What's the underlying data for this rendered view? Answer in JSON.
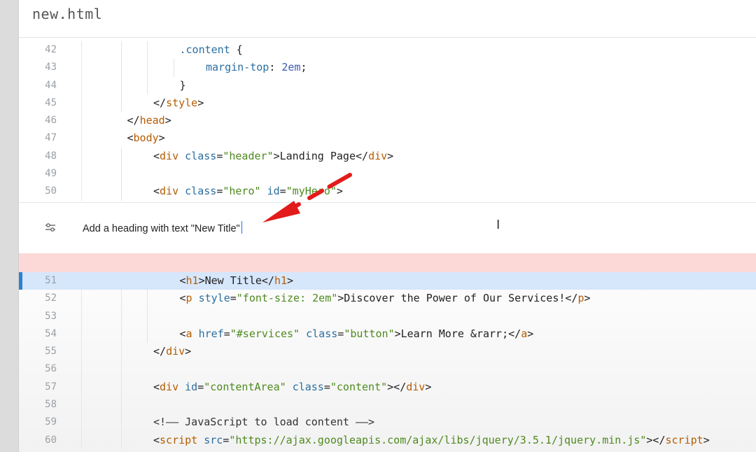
{
  "file": {
    "title": "new.html"
  },
  "code_top": [
    {
      "ln": "42",
      "tokens": [
        [
          "sel",
          ".content "
        ],
        [
          "p",
          "{"
        ]
      ],
      "indent": 3
    },
    {
      "ln": "43",
      "tokens": [
        [
          "a",
          "margin-top"
        ],
        [
          "p",
          ": "
        ],
        [
          "n",
          "2em"
        ],
        [
          "p",
          ";"
        ]
      ],
      "indent": 4
    },
    {
      "ln": "44",
      "tokens": [
        [
          "p",
          "}"
        ]
      ],
      "indent": 3
    },
    {
      "ln": "45",
      "tokens": [
        [
          "p",
          "</"
        ],
        [
          "t",
          "style"
        ],
        [
          "p",
          ">"
        ]
      ],
      "indent": 2
    },
    {
      "ln": "46",
      "tokens": [
        [
          "p",
          "</"
        ],
        [
          "t",
          "head"
        ],
        [
          "p",
          ">"
        ]
      ],
      "indent": 1
    },
    {
      "ln": "47",
      "tokens": [
        [
          "p",
          "<"
        ],
        [
          "t",
          "body"
        ],
        [
          "p",
          ">"
        ]
      ],
      "indent": 1
    },
    {
      "ln": "48",
      "tokens": [
        [
          "p",
          "<"
        ],
        [
          "t",
          "div"
        ],
        [
          "p",
          " "
        ],
        [
          "a",
          "class"
        ],
        [
          "p",
          "="
        ],
        [
          "s",
          "\"header\""
        ],
        [
          "p",
          ">Landing Page</"
        ],
        [
          "t",
          "div"
        ],
        [
          "p",
          ">"
        ]
      ],
      "indent": 2
    },
    {
      "ln": "49",
      "tokens": [],
      "indent": 2
    },
    {
      "ln": "50",
      "tokens": [
        [
          "p",
          "<"
        ],
        [
          "t",
          "div"
        ],
        [
          "p",
          " "
        ],
        [
          "a",
          "class"
        ],
        [
          "p",
          "="
        ],
        [
          "s",
          "\"hero\""
        ],
        [
          "p",
          " "
        ],
        [
          "a",
          "id"
        ],
        [
          "p",
          "="
        ],
        [
          "s",
          "\"myHero\""
        ],
        [
          "p",
          ">"
        ]
      ],
      "indent": 2
    }
  ],
  "prompt": {
    "text": "Add a heading with text \"New Title\"",
    "icon": "sliders-icon"
  },
  "code_bottom": [
    {
      "ln": "51",
      "tokens": [
        [
          "p",
          "<"
        ],
        [
          "t",
          "h1"
        ],
        [
          "p",
          ">New Title</"
        ],
        [
          "t",
          "h1"
        ],
        [
          "p",
          ">"
        ]
      ],
      "indent": 3,
      "highlight": true
    },
    {
      "ln": "52",
      "tokens": [
        [
          "p",
          "<"
        ],
        [
          "t",
          "p"
        ],
        [
          "p",
          " "
        ],
        [
          "a",
          "style"
        ],
        [
          "p",
          "="
        ],
        [
          "s",
          "\"font-size: 2em\""
        ],
        [
          "p",
          ">Discover the Power of Our Services!</"
        ],
        [
          "t",
          "p"
        ],
        [
          "p",
          ">"
        ]
      ],
      "indent": 3
    },
    {
      "ln": "53",
      "tokens": [],
      "indent": 3
    },
    {
      "ln": "54",
      "tokens": [
        [
          "p",
          "<"
        ],
        [
          "t",
          "a"
        ],
        [
          "p",
          " "
        ],
        [
          "a",
          "href"
        ],
        [
          "p",
          "="
        ],
        [
          "s",
          "\"#services\""
        ],
        [
          "p",
          " "
        ],
        [
          "a",
          "class"
        ],
        [
          "p",
          "="
        ],
        [
          "s",
          "\"button\""
        ],
        [
          "p",
          ">Learn More &rarr;</"
        ],
        [
          "t",
          "a"
        ],
        [
          "p",
          ">"
        ]
      ],
      "indent": 3
    },
    {
      "ln": "55",
      "tokens": [
        [
          "p",
          "</"
        ],
        [
          "t",
          "div"
        ],
        [
          "p",
          ">"
        ]
      ],
      "indent": 2
    },
    {
      "ln": "56",
      "tokens": [],
      "indent": 2
    },
    {
      "ln": "57",
      "tokens": [
        [
          "p",
          "<"
        ],
        [
          "t",
          "div"
        ],
        [
          "p",
          " "
        ],
        [
          "a",
          "id"
        ],
        [
          "p",
          "="
        ],
        [
          "s",
          "\"contentArea\""
        ],
        [
          "p",
          " "
        ],
        [
          "a",
          "class"
        ],
        [
          "p",
          "="
        ],
        [
          "s",
          "\"content\""
        ],
        [
          "p",
          "></"
        ],
        [
          "t",
          "div"
        ],
        [
          "p",
          ">"
        ]
      ],
      "indent": 2
    },
    {
      "ln": "58",
      "tokens": [],
      "indent": 2
    },
    {
      "ln": "59",
      "tokens": [
        [
          "c",
          "<!—— JavaScript to load content ——>"
        ]
      ],
      "indent": 2
    },
    {
      "ln": "60",
      "tokens": [
        [
          "p",
          "<"
        ],
        [
          "t",
          "script"
        ],
        [
          "p",
          " "
        ],
        [
          "a",
          "src"
        ],
        [
          "p",
          "="
        ],
        [
          "s",
          "\"https://ajax.googleapis.com/ajax/libs/jquery/3.5.1/jquery.min.js\""
        ],
        [
          "p",
          "></"
        ],
        [
          "t",
          "script"
        ],
        [
          "p",
          ">"
        ]
      ],
      "indent": 2
    }
  ]
}
